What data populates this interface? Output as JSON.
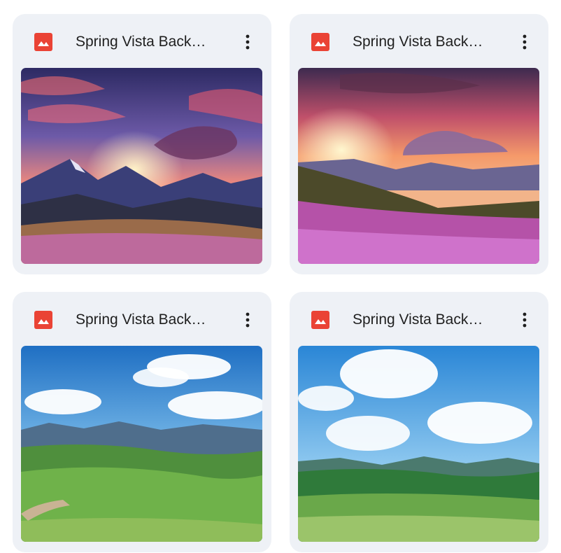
{
  "files": [
    {
      "title": "Spring Vista Back…",
      "icon": "image-file-icon",
      "menu_icon": "more-vert-icon",
      "preview": "sunset-mountains-pink-flowers"
    },
    {
      "title": "Spring Vista Back…",
      "icon": "image-file-icon",
      "menu_icon": "more-vert-icon",
      "preview": "sunset-hillside-purple-flowers"
    },
    {
      "title": "Spring Vista Back…",
      "icon": "image-file-icon",
      "menu_icon": "more-vert-icon",
      "preview": "green-valley-blue-sky-path"
    },
    {
      "title": "Spring Vista Back…",
      "icon": "image-file-icon",
      "menu_icon": "more-vert-icon",
      "preview": "green-valley-blue-sky-clouds"
    }
  ],
  "colors": {
    "card_bg": "#eef1f6",
    "icon_red": "#ea4335",
    "title_text": "#1f1f1f",
    "menu_dots": "#1f1f1f"
  }
}
